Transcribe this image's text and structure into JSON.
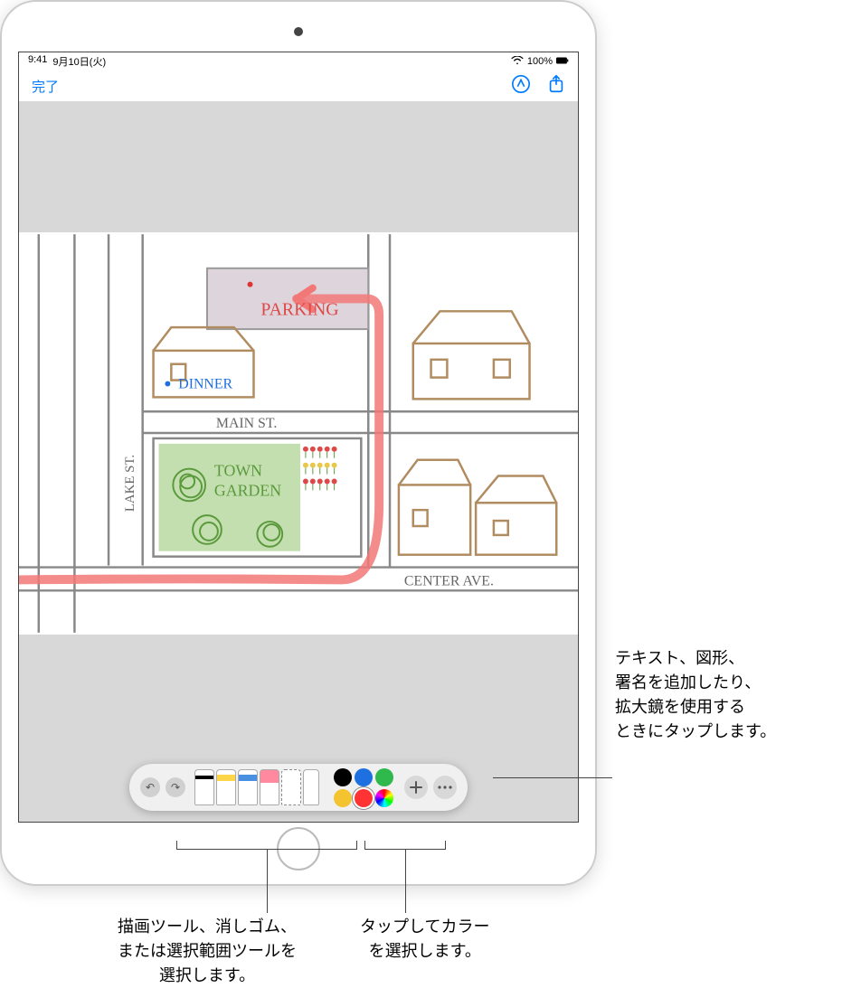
{
  "status": {
    "time": "9:41",
    "date": "9月10日(火)",
    "battery": "100%"
  },
  "nav": {
    "done": "完了"
  },
  "sketch": {
    "labels": {
      "parking": "PARKING",
      "dinner": "DINNER",
      "main_st": "MAIN ST.",
      "lake_st": "LAKE ST.",
      "town_garden_1": "TOWN",
      "town_garden_2": "GARDEN",
      "center_ave": "CENTER AVE."
    }
  },
  "toolbar": {
    "tools": [
      "pen",
      "marker",
      "pencil",
      "eraser",
      "lasso",
      "ruler"
    ],
    "colors": {
      "black": "#000000",
      "blue": "#1e6fe0",
      "green": "#2fb84c",
      "yellow": "#f4c430",
      "red": "#ff3333",
      "wheel": "multi"
    },
    "selected_color": "red"
  },
  "callouts": {
    "add": "テキスト、図形、\n署名を追加したり、\n拡大鏡を使用する\nときにタップします。",
    "colors": "タップしてカラー\nを選択します。",
    "tools": "描画ツール、消しゴム、\nまたは選択範囲ツールを\n選択します。"
  }
}
